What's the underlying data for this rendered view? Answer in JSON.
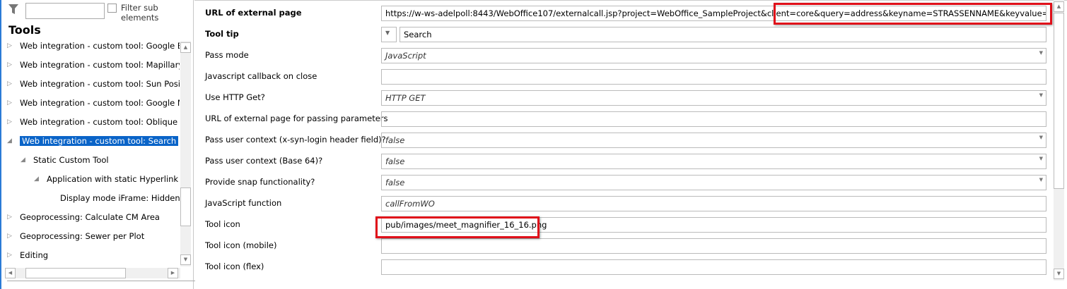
{
  "left_panel": {
    "filter_placeholder": "",
    "filter_sub_label": "Filter sub elements",
    "title": "Tools",
    "tree": [
      {
        "label": "Web integration - custom tool: Google Earth",
        "level": 0,
        "expander": "collapsed"
      },
      {
        "label": "Web integration - custom tool: Mapillary",
        "level": 0,
        "expander": "collapsed"
      },
      {
        "label": "Web integration - custom tool: Sun Position",
        "level": 0,
        "expander": "collapsed"
      },
      {
        "label": "Web integration - custom tool: Google Maps",
        "level": 0,
        "expander": "collapsed"
      },
      {
        "label": "Web integration - custom tool: Oblique Aerial",
        "level": 0,
        "expander": "collapsed"
      },
      {
        "label": "Web integration - custom tool: Search",
        "level": 0,
        "expander": "expanded",
        "selected": true
      },
      {
        "label": "Static Custom Tool",
        "level": 1,
        "expander": "expanded"
      },
      {
        "label": "Application with static Hyperlink",
        "level": 2,
        "expander": "expanded"
      },
      {
        "label": "Display mode iFrame: Hidden",
        "level": 3,
        "expander": "none"
      },
      {
        "label": "Geoprocessing: Calculate CM Area",
        "level": 0,
        "expander": "collapsed"
      },
      {
        "label": "Geoprocessing: Sewer per Plot",
        "level": 0,
        "expander": "collapsed"
      },
      {
        "label": "Editing",
        "level": 0,
        "expander": "collapsed"
      }
    ]
  },
  "properties": [
    {
      "label": "URL of external page",
      "bold": true,
      "value": "https://w-ws-adelpoll:8443/WebOffice107/externalcall.jsp?project=WebOffice_SampleProject&client=core&query=address&keyname=STRASSENNAME&keyvalue=Herrengasse",
      "type": "text"
    },
    {
      "label": "Tool tip",
      "bold": true,
      "value": "Search",
      "type": "tooltip"
    },
    {
      "label": "Pass mode",
      "value": "JavaScript",
      "type": "select"
    },
    {
      "label": "Javascript callback on close",
      "value": "",
      "type": "text"
    },
    {
      "label": "Use HTTP Get?",
      "value": "HTTP GET",
      "type": "select"
    },
    {
      "label": "URL of external page for passing parameters",
      "value": "",
      "type": "text"
    },
    {
      "label": "Pass user context (x-syn-login header field)?",
      "value": "false",
      "type": "select"
    },
    {
      "label": "Pass user context (Base 64)?",
      "value": "false",
      "type": "select"
    },
    {
      "label": "Provide snap functionality?",
      "value": "false",
      "type": "select"
    },
    {
      "label": "JavaScript function",
      "value": "callFromWO",
      "type": "italic"
    },
    {
      "label": "Tool icon",
      "value": "pub/images/meet_magnifier_16_16.png",
      "type": "text"
    },
    {
      "label": "Tool icon (mobile)",
      "value": "",
      "type": "text"
    },
    {
      "label": "Tool icon (flex)",
      "value": "",
      "type": "text"
    }
  ],
  "highlight_color": "#e0101a",
  "selection_color": "#0a64c8"
}
